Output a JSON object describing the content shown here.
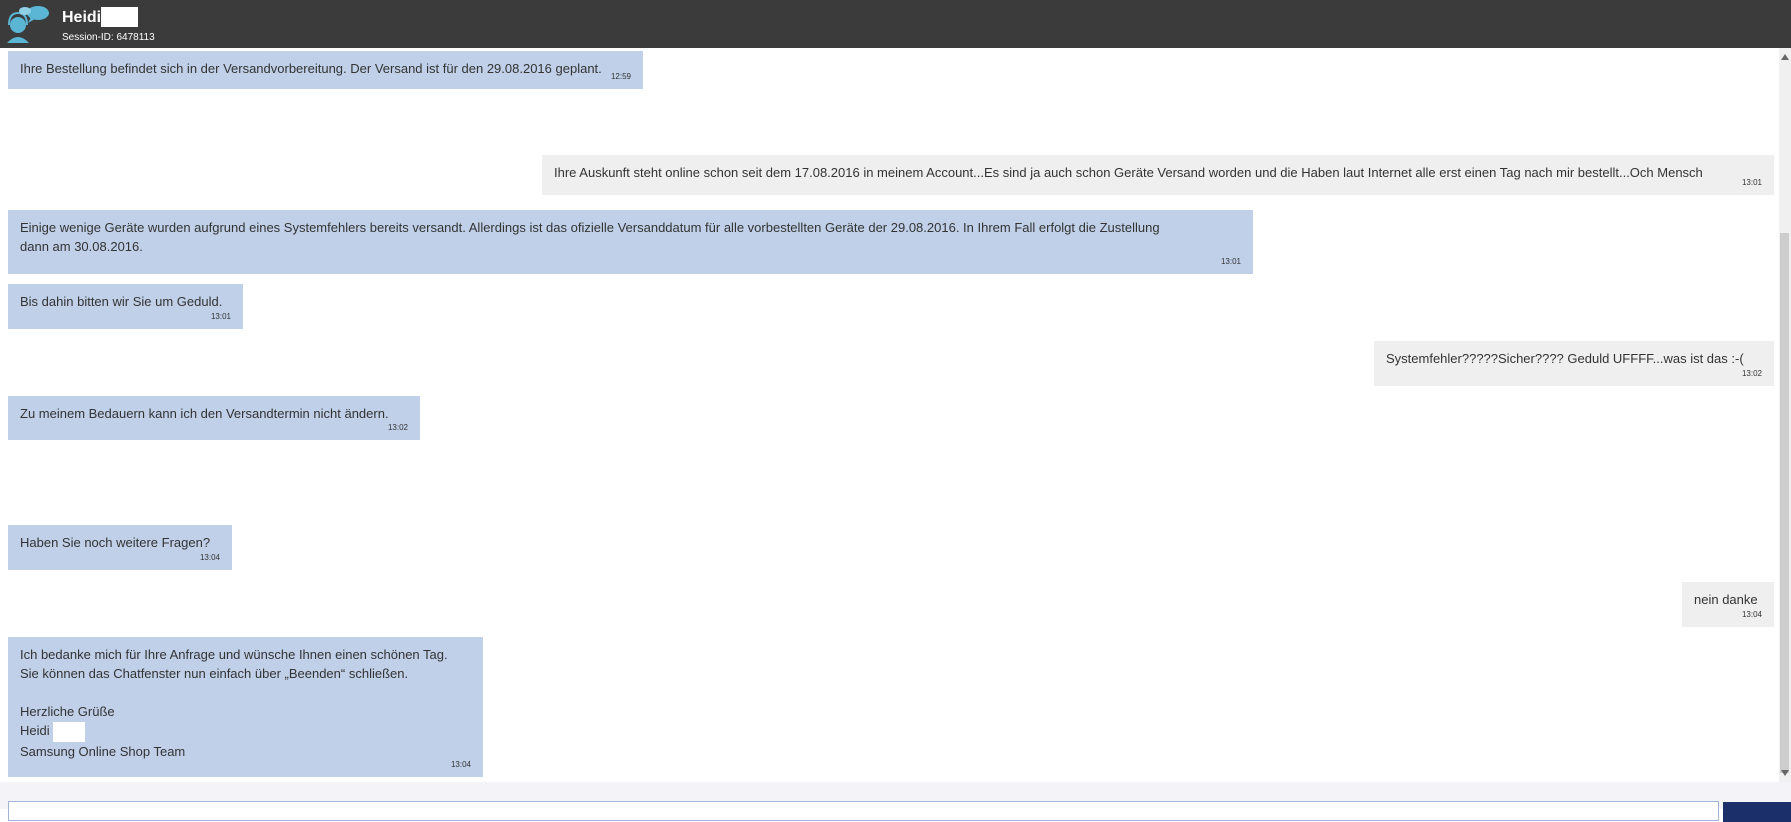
{
  "header": {
    "agent_name": "Heidi",
    "session": "Session-ID: 6478113"
  },
  "messages": [
    {
      "from": "agent",
      "lines": [
        "Ihre Bestellung befindet sich in der Versandvorbereitung. Der Versand ist für den 29.08.2016 geplant."
      ],
      "time": "12:59"
    },
    {
      "from": "user",
      "lines": [
        "Ihre Auskunft steht online schon seit dem 17.08.2016 in meinem Account...Es sind ja auch schon Geräte Versand worden und die Haben laut Internet alle erst einen Tag nach mir bestellt...Och Mensch"
      ],
      "time": "13:01"
    },
    {
      "from": "agent",
      "lines": [
        "Einige wenige Geräte wurden aufgrund eines Systemfehlers bereits versandt. Allerdings ist das ofizielle Versanddatum für alle vorbestellten Geräte der 29.08.2016. In Ihrem Fall erfolgt die Zustellung",
        "dann am 30.08.2016."
      ],
      "time": "13:01"
    },
    {
      "from": "agent",
      "lines": [
        "Bis dahin bitten wir Sie um Geduld."
      ],
      "time": "13:01"
    },
    {
      "from": "user",
      "lines": [
        "Systemfehler?????Sicher???? Geduld UFFFF...was ist das :-("
      ],
      "time": "13:02"
    },
    {
      "from": "agent",
      "lines": [
        "Zu meinem Bedauern kann ich den Versandtermin nicht ändern."
      ],
      "time": "13:02"
    },
    {
      "from": "agent",
      "lines": [
        "Haben Sie noch weitere Fragen?"
      ],
      "time": "13:04"
    },
    {
      "from": "user",
      "lines": [
        "nein danke"
      ],
      "time": "13:04"
    },
    {
      "from": "agent",
      "lines": [
        "Ich bedanke mich für Ihre Anfrage und wünsche Ihnen einen schönen Tag.",
        "Sie können das Chatfenster nun einfach über „Beenden“ schließen.",
        " ",
        "Herzliche Grüße",
        "Heidi",
        "Samsung Online Shop Team"
      ],
      "time": "13:04"
    }
  ],
  "input": {
    "value": "",
    "placeholder": ""
  },
  "colors": {
    "header_bg": "#3b3b3b",
    "agent_bubble": "#c0d0e8",
    "user_bubble": "#efefef",
    "send_button": "#1b2f6b",
    "avatar_accent": "#5bb5d5"
  },
  "icons": {
    "avatar": "agent-headset-speech-bubble-icon"
  }
}
